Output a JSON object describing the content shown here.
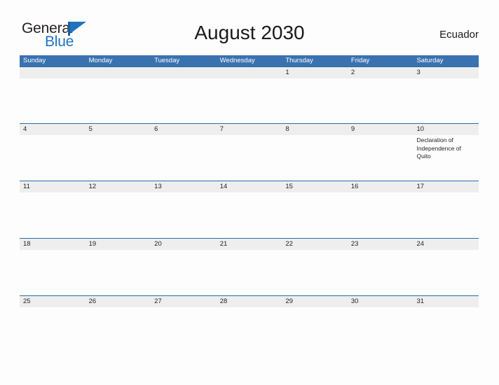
{
  "brand": {
    "name_part1": "General",
    "name_part2": "Blue",
    "flag_icon": "blue-flag-triangle-icon",
    "color_dark": "#231f20",
    "color_blue": "#1f72bb"
  },
  "header": {
    "title": "August 2030",
    "region": "Ecuador"
  },
  "theme": {
    "header_band": "#3a72b0",
    "number_band": "#eeeeee",
    "row_rule": "#2b6ca8",
    "page_background": "#fdfdfd",
    "text": "#231f20"
  },
  "calendar": {
    "month": "August",
    "year": "2030",
    "weekdays": [
      "Sunday",
      "Monday",
      "Tuesday",
      "Wednesday",
      "Thursday",
      "Friday",
      "Saturday"
    ],
    "weeks": [
      {
        "days": [
          {
            "number": "",
            "event": ""
          },
          {
            "number": "",
            "event": ""
          },
          {
            "number": "",
            "event": ""
          },
          {
            "number": "",
            "event": ""
          },
          {
            "number": "1",
            "event": ""
          },
          {
            "number": "2",
            "event": ""
          },
          {
            "number": "3",
            "event": ""
          }
        ]
      },
      {
        "days": [
          {
            "number": "4",
            "event": ""
          },
          {
            "number": "5",
            "event": ""
          },
          {
            "number": "6",
            "event": ""
          },
          {
            "number": "7",
            "event": ""
          },
          {
            "number": "8",
            "event": ""
          },
          {
            "number": "9",
            "event": ""
          },
          {
            "number": "10",
            "event": "Declaration of Independence of Quito"
          }
        ]
      },
      {
        "days": [
          {
            "number": "11",
            "event": ""
          },
          {
            "number": "12",
            "event": ""
          },
          {
            "number": "13",
            "event": ""
          },
          {
            "number": "14",
            "event": ""
          },
          {
            "number": "15",
            "event": ""
          },
          {
            "number": "16",
            "event": ""
          },
          {
            "number": "17",
            "event": ""
          }
        ]
      },
      {
        "days": [
          {
            "number": "18",
            "event": ""
          },
          {
            "number": "19",
            "event": ""
          },
          {
            "number": "20",
            "event": ""
          },
          {
            "number": "21",
            "event": ""
          },
          {
            "number": "22",
            "event": ""
          },
          {
            "number": "23",
            "event": ""
          },
          {
            "number": "24",
            "event": ""
          }
        ]
      },
      {
        "days": [
          {
            "number": "25",
            "event": ""
          },
          {
            "number": "26",
            "event": ""
          },
          {
            "number": "27",
            "event": ""
          },
          {
            "number": "28",
            "event": ""
          },
          {
            "number": "29",
            "event": ""
          },
          {
            "number": "30",
            "event": ""
          },
          {
            "number": "31",
            "event": ""
          }
        ]
      }
    ]
  }
}
